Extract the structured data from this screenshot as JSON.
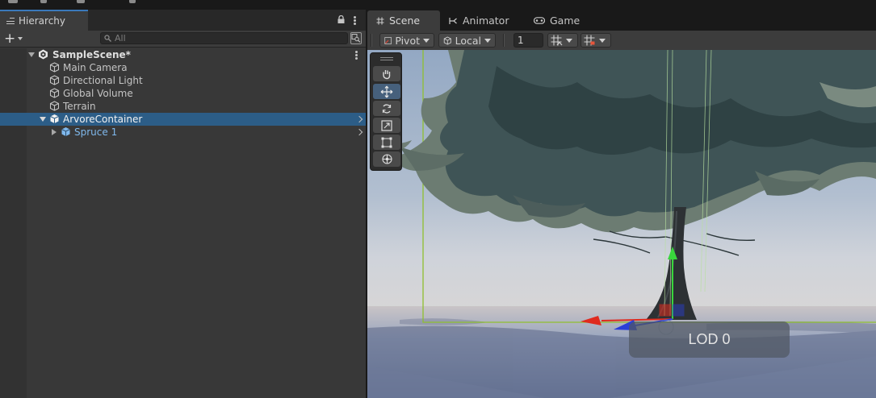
{
  "hierarchy": {
    "tab_label": "Hierarchy",
    "search_placeholder": "All",
    "scene_name": "SampleScene*",
    "items": [
      {
        "label": "Main Camera"
      },
      {
        "label": "Directional Light"
      },
      {
        "label": "Global Volume"
      },
      {
        "label": "Terrain"
      },
      {
        "label": "ArvoreContainer",
        "selected": true
      },
      {
        "label": "Spruce 1",
        "prefab": true
      }
    ]
  },
  "scene_view": {
    "tabs": [
      {
        "label": "Scene",
        "icon": "hash-icon",
        "active": true
      },
      {
        "label": "Animator",
        "icon": "animator-icon"
      },
      {
        "label": "Game",
        "icon": "gamepad-icon"
      }
    ],
    "toolbar": {
      "pivot_label": "Pivot",
      "space_label": "Local",
      "grid_snap_value": "1"
    },
    "tools": [
      "hand-icon",
      "move-icon",
      "rotate-icon",
      "scale-icon",
      "rect-icon",
      "transform-icon"
    ],
    "active_tool": "move-icon",
    "lod_label": "LOD 0"
  },
  "colors": {
    "selection": "#2c5d87",
    "accent_tab": "#3a79bb",
    "prefab_text": "#7fb8ec",
    "gizmo_y": "#39d63c",
    "gizmo_x": "#e02a1e",
    "gizmo_z": "#2a3fd8"
  }
}
